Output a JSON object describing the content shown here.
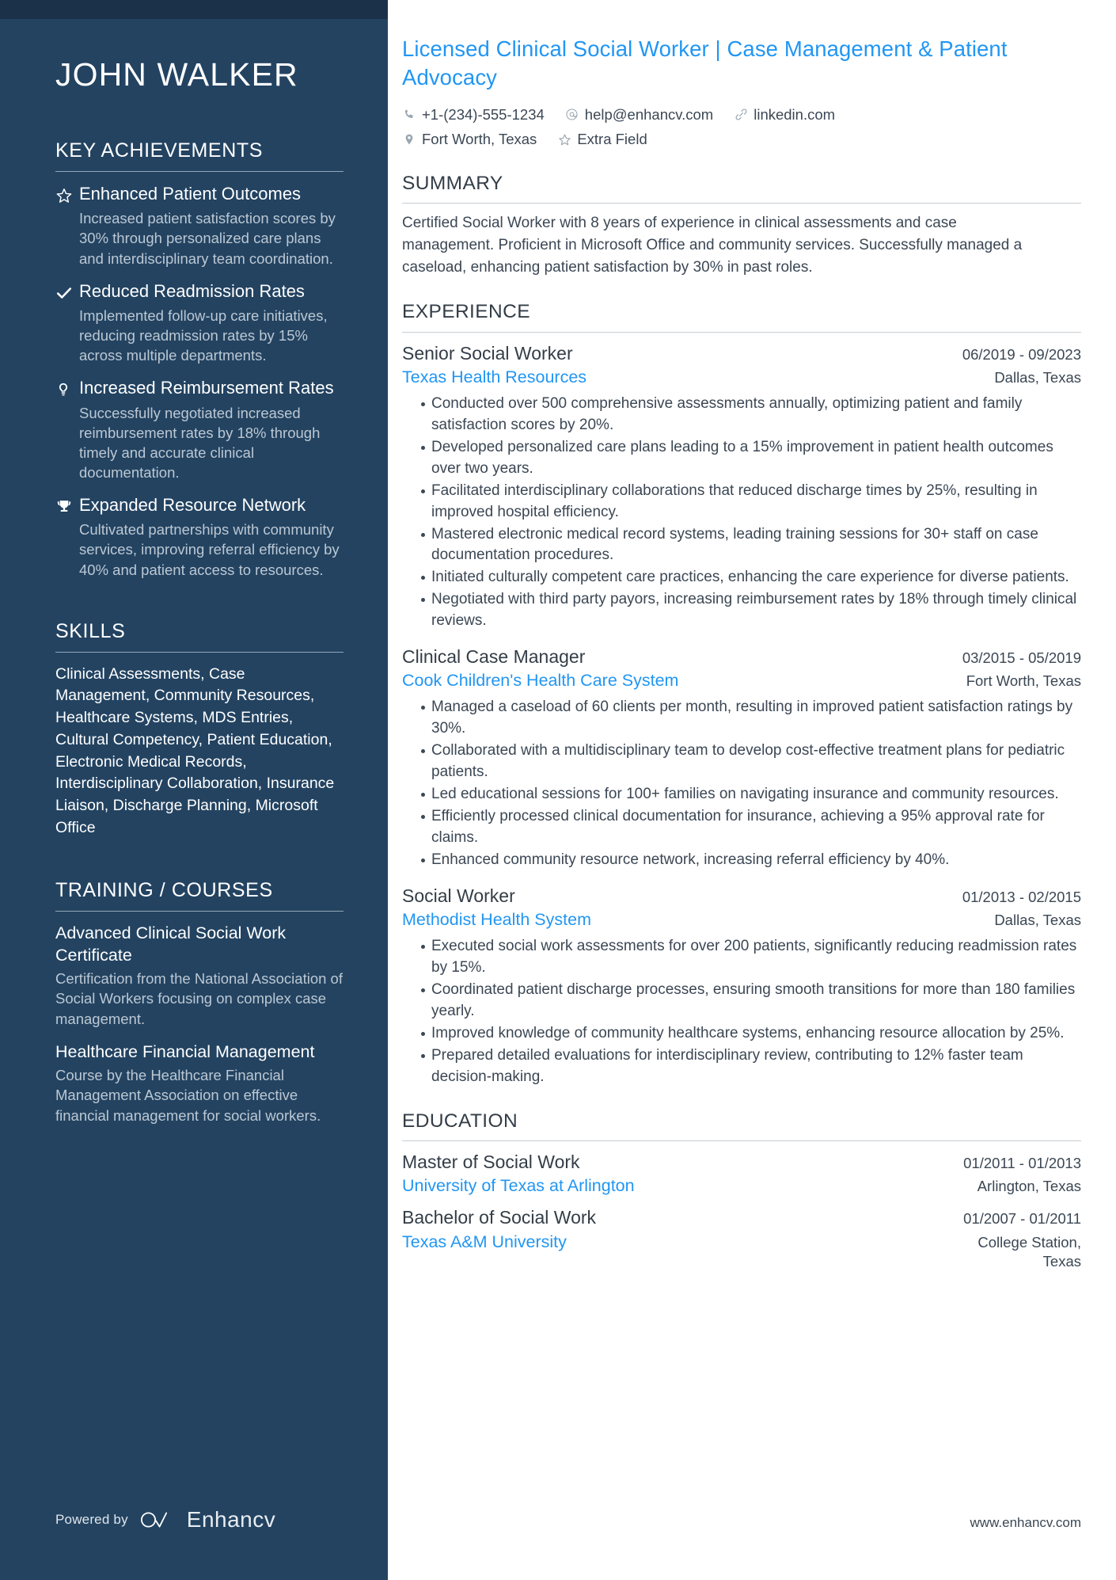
{
  "sidebar": {
    "name": "JOHN WALKER",
    "achievements_heading": "KEY ACHIEVEMENTS",
    "achievements": [
      {
        "icon": "star-icon",
        "title": "Enhanced Patient Outcomes",
        "desc": "Increased patient satisfaction scores by 30% through personalized care plans and interdisciplinary team coordination."
      },
      {
        "icon": "check-icon",
        "title": "Reduced Readmission Rates",
        "desc": "Implemented follow-up care initiatives, reducing readmission rates by 15% across multiple departments."
      },
      {
        "icon": "lightbulb-icon",
        "title": "Increased Reimbursement Rates",
        "desc": "Successfully negotiated increased reimbursement rates by 18% through timely and accurate clinical documentation."
      },
      {
        "icon": "trophy-icon",
        "title": "Expanded Resource Network",
        "desc": "Cultivated partnerships with community services, improving referral efficiency by 40% and patient access to resources."
      }
    ],
    "skills_heading": "SKILLS",
    "skills_text": "Clinical Assessments, Case Management, Community Resources, Healthcare Systems, MDS Entries, Cultural Competency, Patient Education, Electronic Medical Records, Interdisciplinary Collaboration, Insurance Liaison, Discharge Planning, Microsoft Office",
    "training_heading": "TRAINING / COURSES",
    "training": [
      {
        "title": "Advanced Clinical Social Work Certificate",
        "desc": "Certification from the National Association of Social Workers focusing on complex case management."
      },
      {
        "title": "Healthcare Financial Management",
        "desc": "Course by the Healthcare Financial Management Association on effective financial management for social workers."
      }
    ],
    "powered_by_label": "Powered by",
    "brand_name": "Enhancv"
  },
  "header": {
    "headline": "Licensed Clinical Social Worker | Case Management & Patient Advocacy",
    "contacts_row1": [
      {
        "icon": "phone-icon",
        "text": "+1-(234)-555-1234"
      },
      {
        "icon": "at-email-icon",
        "text": "help@enhancv.com"
      },
      {
        "icon": "link-icon",
        "text": "linkedin.com"
      }
    ],
    "contacts_row2": [
      {
        "icon": "location-pin-icon",
        "text": "Fort Worth, Texas"
      },
      {
        "icon": "star-icon",
        "text": "Extra Field"
      }
    ]
  },
  "summary": {
    "heading": "SUMMARY",
    "text": "Certified Social Worker with 8 years of experience in clinical assessments and case management. Proficient in Microsoft Office and community services. Successfully managed a caseload, enhancing patient satisfaction by 30% in past roles."
  },
  "experience": {
    "heading": "EXPERIENCE",
    "entries": [
      {
        "title": "Senior Social Worker",
        "date": "06/2019 - 09/2023",
        "org": "Texas Health Resources",
        "location": "Dallas, Texas",
        "bullets": [
          "Conducted over 500 comprehensive assessments annually, optimizing patient and family satisfaction scores by 20%.",
          "Developed personalized care plans leading to a 15% improvement in patient health outcomes over two years.",
          "Facilitated interdisciplinary collaborations that reduced discharge times by 25%, resulting in improved hospital efficiency.",
          "Mastered electronic medical record systems, leading training sessions for 30+ staff on case documentation procedures.",
          "Initiated culturally competent care practices, enhancing the care experience for diverse patients.",
          "Negotiated with third party payors, increasing reimbursement rates by 18% through timely clinical reviews."
        ]
      },
      {
        "title": "Clinical Case Manager",
        "date": "03/2015 - 05/2019",
        "org": "Cook Children's Health Care System",
        "location": "Fort Worth, Texas",
        "bullets": [
          "Managed a caseload of 60 clients per month, resulting in improved patient satisfaction ratings by 30%.",
          "Collaborated with a multidisciplinary team to develop cost-effective treatment plans for pediatric patients.",
          "Led educational sessions for 100+ families on navigating insurance and community resources.",
          "Efficiently processed clinical documentation for insurance, achieving a 95% approval rate for claims.",
          "Enhanced community resource network, increasing referral efficiency by 40%."
        ]
      },
      {
        "title": "Social Worker",
        "date": "01/2013 - 02/2015",
        "org": "Methodist Health System",
        "location": "Dallas, Texas",
        "bullets": [
          "Executed social work assessments for over 200 patients, significantly reducing readmission rates by 15%.",
          "Coordinated patient discharge processes, ensuring smooth transitions for more than 180 families yearly.",
          "Improved knowledge of community healthcare systems, enhancing resource allocation by 25%.",
          "Prepared detailed evaluations for interdisciplinary review, contributing to 12% faster team decision-making."
        ]
      }
    ]
  },
  "education": {
    "heading": "EDUCATION",
    "entries": [
      {
        "title": "Master of Social Work",
        "date": "01/2011 - 01/2013",
        "org": "University of Texas at Arlington",
        "location": "Arlington, Texas"
      },
      {
        "title": "Bachelor of Social Work",
        "date": "01/2007 - 01/2011",
        "org": "Texas A&M University",
        "location": "College Station, Texas"
      }
    ]
  },
  "footer": {
    "site_url": "www.enhancv.com"
  },
  "colors": {
    "sidebar_bg": "#234361",
    "sidebar_topbar": "#1b3149",
    "accent_blue": "#2196f3",
    "body_text": "#3b4754",
    "heading_text": "#333d47",
    "muted_sidebar_text": "#bcc8d3"
  }
}
